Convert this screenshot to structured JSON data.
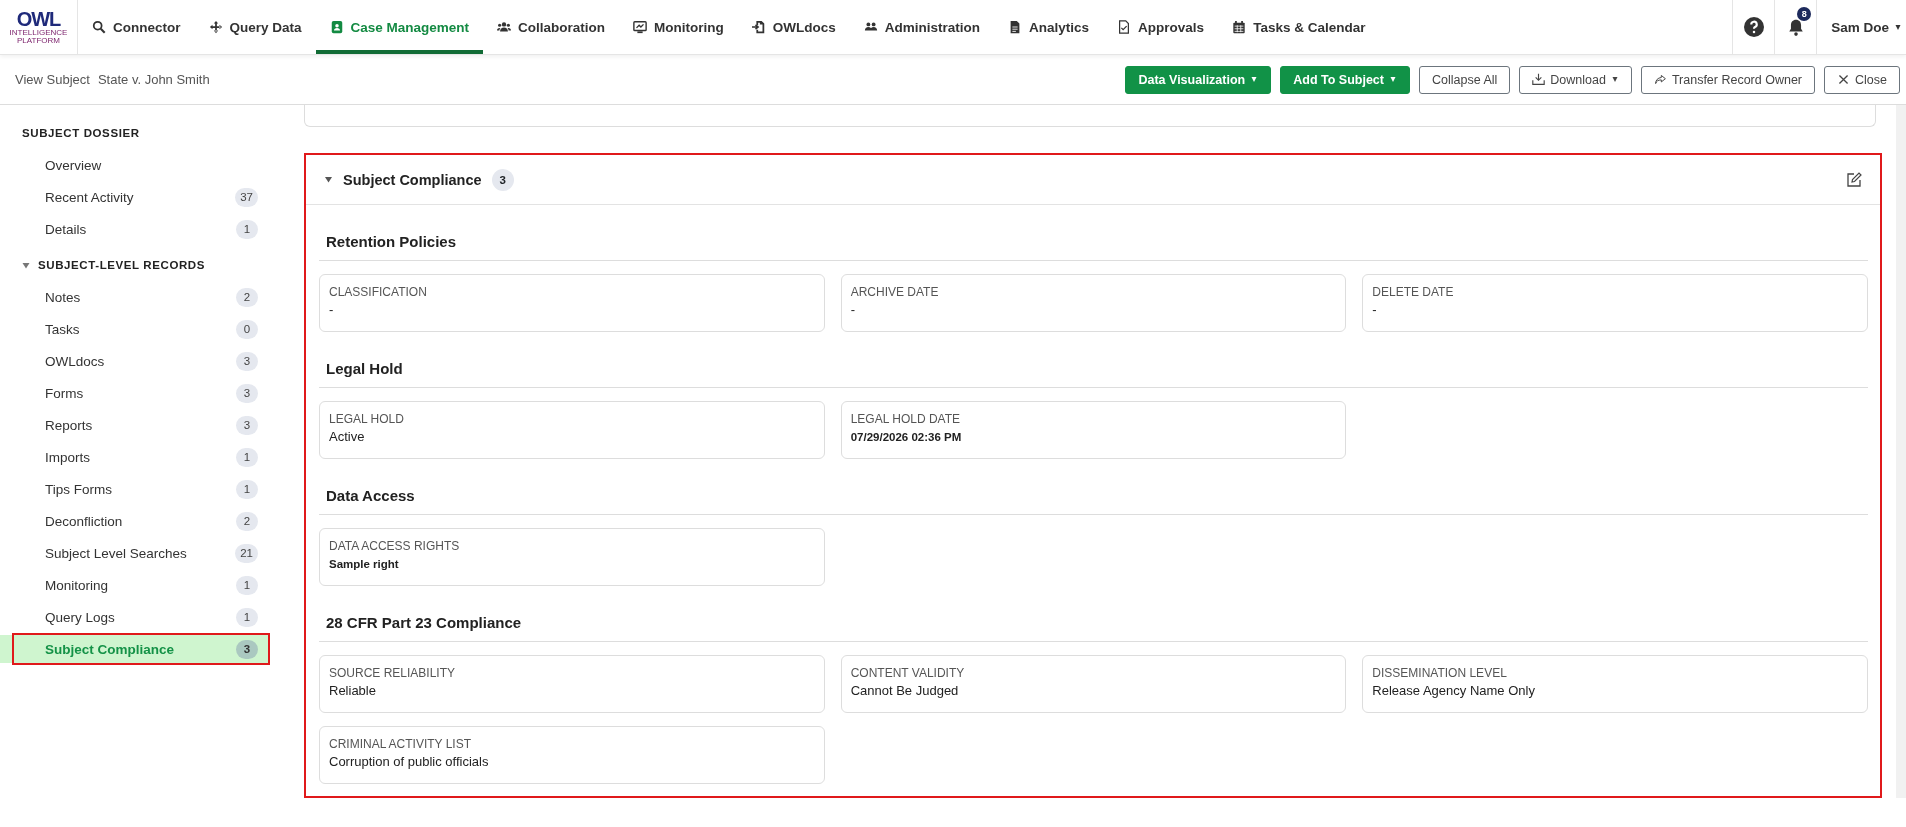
{
  "nav": {
    "logo": {
      "title": "OWL",
      "subtitle": "INTELLIGENCE PLATFORM"
    },
    "items": [
      {
        "label": "Connector",
        "selected": false
      },
      {
        "label": "Query Data",
        "selected": false
      },
      {
        "label": "Case Management",
        "selected": true
      },
      {
        "label": "Collaboration",
        "selected": false
      },
      {
        "label": "Monitoring",
        "selected": false
      },
      {
        "label": "OWLdocs",
        "selected": false
      },
      {
        "label": "Administration",
        "selected": false
      },
      {
        "label": "Analytics",
        "selected": false
      },
      {
        "label": "Approvals",
        "selected": false
      },
      {
        "label": "Tasks & Calendar",
        "selected": false
      }
    ],
    "notifications": "8",
    "user": "Sam Doe"
  },
  "header": {
    "breadcrumb": [
      "View Subject",
      "State v. John Smith"
    ],
    "buttons": [
      {
        "label": "Data Visualization",
        "kind": "primary",
        "dropdown": true
      },
      {
        "label": "Add To Subject",
        "kind": "primary",
        "dropdown": true
      },
      {
        "label": "Collapse All",
        "kind": "outline",
        "dropdown": false
      },
      {
        "label": "Download",
        "kind": "outline",
        "dropdown": true
      },
      {
        "label": "Transfer Record Owner",
        "kind": "outline",
        "dropdown": false
      },
      {
        "label": "Close",
        "kind": "outline",
        "dropdown": false
      }
    ]
  },
  "sidebar": {
    "sections": [
      {
        "title": "SUBJECT DOSSIER",
        "items": [
          {
            "label": "Overview",
            "selected": false
          },
          {
            "label": "Recent Activity",
            "count": "37",
            "selected": false
          },
          {
            "label": "Details",
            "count": "1",
            "selected": false
          }
        ]
      },
      {
        "title": "SUBJECT-LEVEL RECORDS",
        "expanded": true,
        "items": [
          {
            "label": "Notes",
            "count": "2",
            "selected": false
          },
          {
            "label": "Tasks",
            "count": "0",
            "selected": false
          },
          {
            "label": "OWLdocs",
            "count": "3",
            "selected": false
          },
          {
            "label": "Forms",
            "count": "3",
            "selected": false
          },
          {
            "label": "Reports",
            "count": "3",
            "selected": false
          },
          {
            "label": "Imports",
            "count": "1",
            "selected": false
          },
          {
            "label": "Tips Forms",
            "count": "1",
            "selected": false
          },
          {
            "label": "Deconfliction",
            "count": "2",
            "selected": false
          },
          {
            "label": "Subject Level Searches",
            "count": "21",
            "selected": false
          },
          {
            "label": "Monitoring",
            "count": "1",
            "selected": false
          },
          {
            "label": "Query Logs",
            "count": "1",
            "selected": false
          },
          {
            "label": "Subject Compliance",
            "count": "3",
            "selected": true
          }
        ]
      }
    ]
  },
  "panel": {
    "title": "Subject Compliance",
    "count": "3",
    "expanded": true,
    "groups": [
      {
        "title": "Retention Policies",
        "fields": [
          {
            "label": "CLASSIFICATION",
            "value": "-",
            "kind": "plain"
          },
          {
            "label": "ARCHIVE DATE",
            "value": "-",
            "kind": "plain"
          },
          {
            "label": "DELETE DATE",
            "value": "-",
            "kind": "plain"
          }
        ]
      },
      {
        "title": "Legal Hold",
        "fields": [
          {
            "label": "LEGAL HOLD",
            "value": "Active",
            "kind": "plain"
          },
          {
            "label": "LEGAL HOLD DATE",
            "value": "07/29/2026 02:36 PM",
            "kind": "strong"
          }
        ]
      },
      {
        "title": "Data Access",
        "fields": [
          {
            "label": "DATA ACCESS RIGHTS",
            "value": "Sample right",
            "kind": "strong"
          }
        ]
      },
      {
        "title": "28 CFR Part 23 Compliance",
        "fields": [
          {
            "label": "SOURCE RELIABILITY",
            "value": "Reliable",
            "kind": "plain"
          },
          {
            "label": "CONTENT VALIDITY",
            "value": "Cannot Be Judged",
            "kind": "plain"
          },
          {
            "label": "DISSEMINATION LEVEL",
            "value": "Release Agency Name Only",
            "kind": "plain"
          },
          {
            "label": "CRIMINAL ACTIVITY LIST",
            "value": "Corruption of public officials",
            "kind": "plain"
          }
        ]
      }
    ]
  }
}
